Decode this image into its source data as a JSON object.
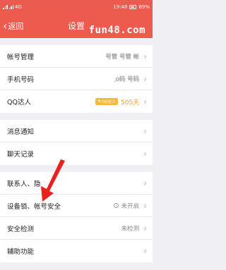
{
  "status_bar": {
    "left": "4G",
    "time": "19:48",
    "battery": "69%"
  },
  "header": {
    "back_label": "返回",
    "title": "设置",
    "watermark": "fun48.com"
  },
  "account_group": {
    "account_manage": {
      "label": "帐号管理",
      "value": "号管  号管 帐"
    },
    "phone": {
      "label": "手机号码",
      "value": "ˌo码  号码"
    },
    "qq_talent": {
      "label": "QQ达人",
      "badge": "QQ达人",
      "days": "505天"
    }
  },
  "notify_group": {
    "message_notify": {
      "label": "消息通知"
    },
    "chat_history": {
      "label": "聊天记录"
    }
  },
  "security_group": {
    "contacts_privacy": {
      "label": "联系人、隐"
    },
    "device_lock": {
      "label": "设备锁、帐号安全",
      "status": "未开启"
    },
    "security_check": {
      "label": "安全检测",
      "status": "未检测"
    },
    "accessibility": {
      "label": "辅助功能"
    }
  },
  "colors": {
    "header_red": "#ef5a4f",
    "arrow_red": "#e8231e",
    "qq_badge": "#f8b93a"
  },
  "icons": {
    "back": "chevron-left-icon",
    "row_arrow": "chevron-right-icon",
    "lock": "lock-status-icon",
    "pointer": "red-arrow-annotation"
  }
}
